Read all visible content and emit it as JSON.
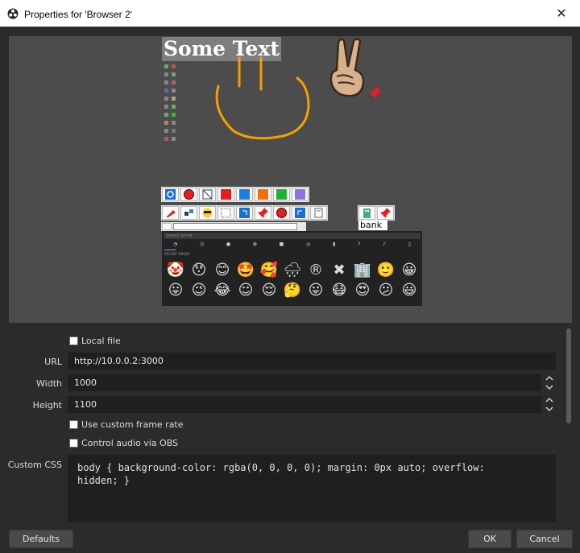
{
  "window": {
    "title": "Properties for 'Browser 2'",
    "close_label": "✕"
  },
  "preview": {
    "overlay_text": "Some Text",
    "bank_label": "bank",
    "emoji_search_placeholder": "Search emoji",
    "emoji_section_label": "RECENT EMOJIS",
    "emoji_rows": [
      [
        "🤡",
        "😯",
        "😊",
        "🤩",
        "🥰",
        "🌧",
        "®",
        "✖",
        "🏢",
        "🙂",
        "😀"
      ],
      [
        "😛",
        "😉",
        "😂",
        "☺",
        "😌",
        "🤔",
        "😛",
        "😷",
        "😍",
        "😕",
        "😃"
      ]
    ]
  },
  "form": {
    "local_file": {
      "label": "Local file",
      "checked": false
    },
    "url": {
      "label": "URL",
      "value": "http://10.0.0.2:3000"
    },
    "width": {
      "label": "Width",
      "value": "1000"
    },
    "height": {
      "label": "Height",
      "value": "1100"
    },
    "custom_frame_rate": {
      "label": "Use custom frame rate",
      "checked": false
    },
    "control_audio": {
      "label": "Control audio via OBS",
      "checked": false
    },
    "custom_css": {
      "label": "Custom CSS",
      "value": "body { background-color: rgba(0, 0, 0, 0); margin: 0px auto; overflow:\nhidden; }"
    }
  },
  "buttons": {
    "defaults": "Defaults",
    "ok": "OK",
    "cancel": "Cancel"
  },
  "colors": {
    "background": "#2b2b2b",
    "preview_bg": "#4c4c4c",
    "field_bg": "#1f1f1f",
    "scribble": "#f5a000"
  }
}
